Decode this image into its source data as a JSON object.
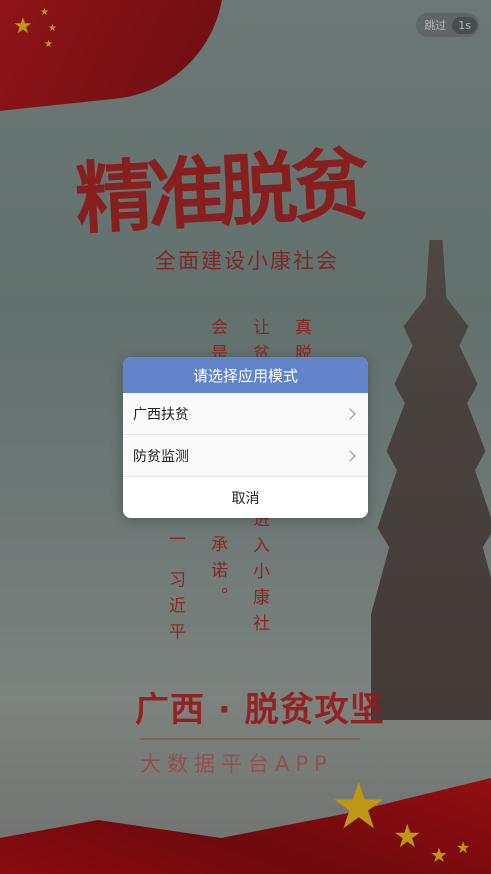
{
  "splash": {
    "title_calligraphy": "精准脱贫",
    "subtitle_calligraphy": "全面建设小康社会",
    "poem_columns": [
      "真脱",
      "让贫",
      "会是",
      "一 习近平",
      "承诺。",
      "进入小康社"
    ],
    "headline": "广西 · 脱贫攻坚",
    "app_line": "大数据平台APP",
    "skip_label": "跳过",
    "skip_count": "1s"
  },
  "dialog": {
    "title": "请选择应用模式",
    "options": [
      {
        "label": "广西扶贫"
      },
      {
        "label": "防贫监测"
      }
    ],
    "cancel_label": "取消"
  }
}
